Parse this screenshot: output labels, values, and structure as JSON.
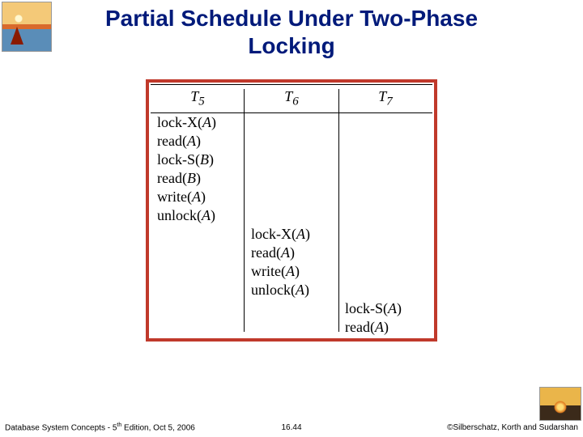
{
  "title_line1": "Partial Schedule Under Two-Phase",
  "title_line2": "Locking",
  "chart_data": {
    "type": "table",
    "columns": [
      "T5",
      "T6",
      "T7"
    ],
    "rows": [
      {
        "T5": "lock-X(A)",
        "T6": "",
        "T7": ""
      },
      {
        "T5": "read(A)",
        "T6": "",
        "T7": ""
      },
      {
        "T5": "lock-S(B)",
        "T6": "",
        "T7": ""
      },
      {
        "T5": "read(B)",
        "T6": "",
        "T7": ""
      },
      {
        "T5": "write(A)",
        "T6": "",
        "T7": ""
      },
      {
        "T5": "unlock(A)",
        "T6": "",
        "T7": ""
      },
      {
        "T5": "",
        "T6": "lock-X(A)",
        "T7": ""
      },
      {
        "T5": "",
        "T6": "read(A)",
        "T7": ""
      },
      {
        "T5": "",
        "T6": "write(A)",
        "T7": ""
      },
      {
        "T5": "",
        "T6": "unlock(A)",
        "T7": ""
      },
      {
        "T5": "",
        "T6": "",
        "T7": "lock-S(A)"
      },
      {
        "T5": "",
        "T6": "",
        "T7": "read(A)"
      }
    ]
  },
  "header": {
    "t5_label": "T",
    "t5_sub": "5",
    "t6_label": "T",
    "t6_sub": "6",
    "t7_label": "T",
    "t7_sub": "7"
  },
  "ops": {
    "lockx": "lock-X",
    "locks": "lock-S",
    "read": "read",
    "write": "write",
    "unlock": "unlock",
    "A": "A",
    "B": "B"
  },
  "footer": {
    "left_prefix": "Database System Concepts - 5",
    "left_sup": "th",
    "left_suffix": " Edition, Oct 5, 2006",
    "center": "16.44",
    "right": "©Silberschatz, Korth and Sudarshan"
  }
}
